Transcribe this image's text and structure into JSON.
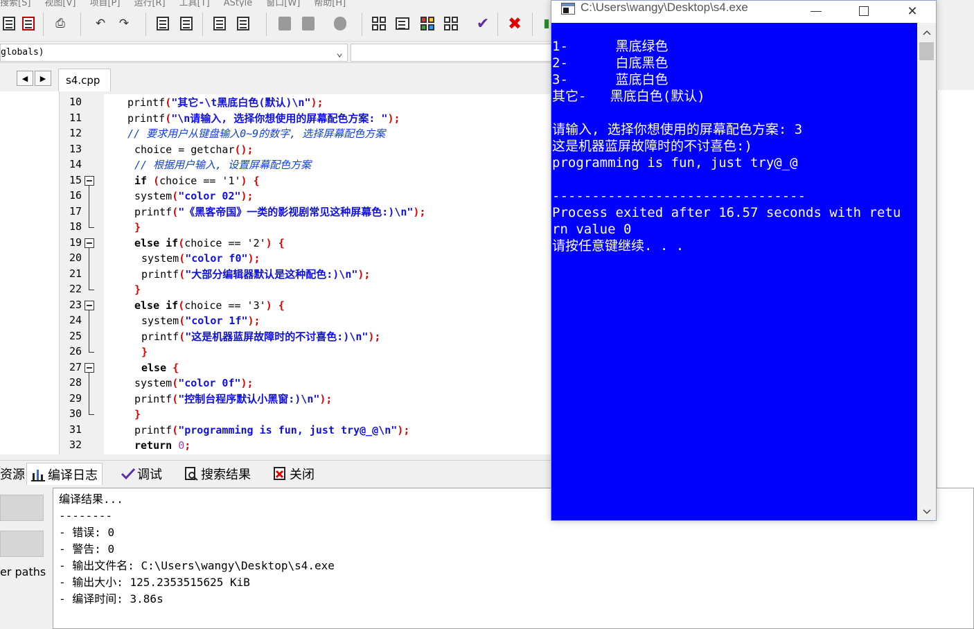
{
  "ide": {
    "menu": [
      "搜索[S]",
      "视图[V]",
      "项目[P]",
      "运行[R]",
      "工具[T]",
      "AStyle",
      "窗口[W]",
      "帮助[H]"
    ],
    "scope_combo_value": "globals)",
    "nav_prev": "◀",
    "nav_next": "▶",
    "file_tab": "s4.cpp",
    "code_lines": [
      {
        "n": "10",
        "x": 34,
        "parts": [
          [
            "fn",
            "printf"
          ],
          [
            "pun",
            "("
          ],
          [
            "str",
            "\"其它-\\t黑底白色(默认)\\n\""
          ],
          [
            "pun",
            ");"
          ]
        ]
      },
      {
        "n": "11",
        "x": 34,
        "parts": [
          [
            "fn",
            "printf"
          ],
          [
            "pun",
            "("
          ],
          [
            "str",
            "\"\\n请输入, 选择你想使用的屏幕配色方案: \""
          ],
          [
            "pun",
            ");"
          ]
        ]
      },
      {
        "n": "12",
        "x": 34,
        "parts": [
          [
            "cmt",
            "// 要求用户从键盘输入0~9的数字, 选择屏幕配色方案"
          ]
        ]
      },
      {
        "n": "13",
        "x": 44,
        "parts": [
          [
            "fn",
            "choice = getchar"
          ],
          [
            "pun",
            "();"
          ]
        ]
      },
      {
        "n": "14",
        "x": 44,
        "parts": [
          [
            "cmt",
            "// 根据用户输入, 设置屏幕配色方案"
          ]
        ]
      },
      {
        "n": "15",
        "x": 44,
        "parts": [
          [
            "kw",
            "if "
          ],
          [
            "pun",
            "("
          ],
          [
            "fn",
            "choice == '1'"
          ],
          [
            "pun",
            ") {"
          ]
        ]
      },
      {
        "n": "16",
        "x": 44,
        "parts": [
          [
            "fn",
            "system"
          ],
          [
            "pun",
            "("
          ],
          [
            "str",
            "\"color 02\""
          ],
          [
            "pun",
            ");"
          ]
        ]
      },
      {
        "n": "17",
        "x": 44,
        "parts": [
          [
            "fn",
            "printf"
          ],
          [
            "pun",
            "("
          ],
          [
            "str",
            "\"《黑客帝国》一类的影视剧常见这种屏幕色:)\\n\""
          ],
          [
            "pun",
            ");"
          ]
        ]
      },
      {
        "n": "18",
        "x": 44,
        "parts": [
          [
            "pun",
            "}"
          ]
        ]
      },
      {
        "n": "19",
        "x": 44,
        "parts": [
          [
            "kw",
            "else if"
          ],
          [
            "pun",
            "("
          ],
          [
            "fn",
            "choice == '2'"
          ],
          [
            "pun",
            ") {"
          ]
        ]
      },
      {
        "n": "20",
        "x": 54,
        "parts": [
          [
            "fn",
            "system"
          ],
          [
            "pun",
            "("
          ],
          [
            "str",
            "\"color f0\""
          ],
          [
            "pun",
            ");"
          ]
        ]
      },
      {
        "n": "21",
        "x": 54,
        "parts": [
          [
            "fn",
            "printf"
          ],
          [
            "pun",
            "("
          ],
          [
            "str",
            "\"大部分编辑器默认是这种配色:)\\n\""
          ],
          [
            "pun",
            ");"
          ]
        ]
      },
      {
        "n": "22",
        "x": 44,
        "parts": [
          [
            "pun",
            "}"
          ]
        ]
      },
      {
        "n": "23",
        "x": 44,
        "parts": [
          [
            "kw",
            "else if"
          ],
          [
            "pun",
            "("
          ],
          [
            "fn",
            "choice == '3'"
          ],
          [
            "pun",
            ") {"
          ]
        ]
      },
      {
        "n": "24",
        "x": 54,
        "parts": [
          [
            "fn",
            "system"
          ],
          [
            "pun",
            "("
          ],
          [
            "str",
            "\"color 1f\""
          ],
          [
            "pun",
            ");"
          ]
        ]
      },
      {
        "n": "25",
        "x": 54,
        "parts": [
          [
            "fn",
            "printf"
          ],
          [
            "pun",
            "("
          ],
          [
            "str",
            "\"这是机器蓝屏故障时的不讨喜色:)\\n\""
          ],
          [
            "pun",
            ");"
          ]
        ]
      },
      {
        "n": "26",
        "x": 54,
        "parts": [
          [
            "pun",
            "}"
          ]
        ]
      },
      {
        "n": "27",
        "x": 54,
        "parts": [
          [
            "kw",
            "else "
          ],
          [
            "pun",
            "{"
          ]
        ]
      },
      {
        "n": "28",
        "x": 44,
        "parts": [
          [
            "fn",
            "system"
          ],
          [
            "pun",
            "("
          ],
          [
            "str",
            "\"color 0f\""
          ],
          [
            "pun",
            ");"
          ]
        ]
      },
      {
        "n": "29",
        "x": 44,
        "parts": [
          [
            "fn",
            "printf"
          ],
          [
            "pun",
            "("
          ],
          [
            "str",
            "\"控制台程序默认小黑窗:)\\n\""
          ],
          [
            "pun",
            ");"
          ]
        ]
      },
      {
        "n": "30",
        "x": 44,
        "parts": [
          [
            "pun",
            "}"
          ]
        ]
      },
      {
        "n": "31",
        "x": 44,
        "parts": [
          [
            "fn",
            "printf"
          ],
          [
            "pun",
            "("
          ],
          [
            "str",
            "\"programming is fun, just try@_@\\n\""
          ],
          [
            "pun",
            ");"
          ]
        ]
      },
      {
        "n": "32",
        "x": 44,
        "parts": [
          [
            "kw",
            "return "
          ],
          [
            "num",
            "0"
          ],
          [
            "pun",
            ";"
          ]
        ]
      }
    ],
    "bottom_tabs": [
      "资源",
      "编译日志",
      "调试",
      "搜索结果",
      "关闭"
    ],
    "paths_label": "er paths",
    "log_lines": [
      "编译结果...",
      "--------",
      "- 错误: 0",
      "- 警告: 0",
      "- 输出文件名: C:\\Users\\wangy\\Desktop\\s4.exe",
      "- 输出大小: 125.2353515625 KiB",
      "- 编译时间: 3.86s"
    ]
  },
  "console": {
    "title": "C:\\Users\\wangy\\Desktop\\s4.exe",
    "minimize": "—",
    "close": "✕",
    "scroll_up": "︿",
    "scroll_down": "﹀",
    "lines": [
      "1-      黑底绿色",
      "2-      白底黑色",
      "3-      蓝底白色",
      "其它-   黑底白色(默认)",
      "",
      "请输入, 选择你想使用的屏幕配色方案: 3",
      "这是机器蓝屏故障时的不讨喜色:)",
      "programming is fun, just try@_@",
      "",
      "--------------------------------",
      "Process exited after 16.57 seconds with retu",
      "rn value 0",
      "请按任意键继续. . ."
    ],
    "background": "#0000ff",
    "foreground": "#ffffff"
  }
}
